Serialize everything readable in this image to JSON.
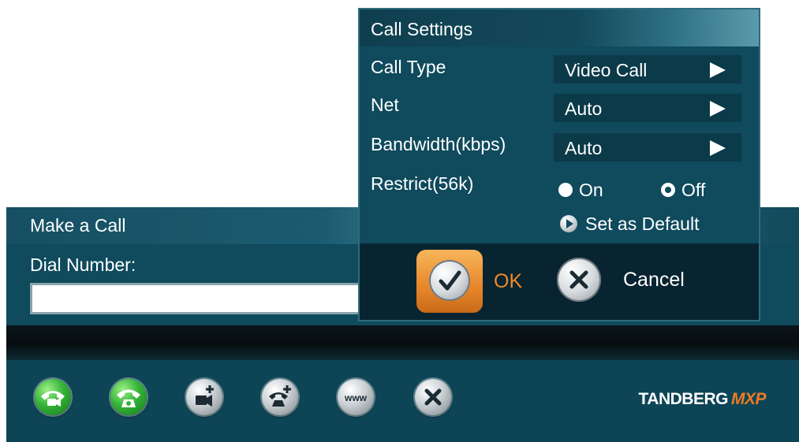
{
  "make_call": {
    "title": "Make a Call",
    "dial_label": "Dial Number:",
    "dial_value": ""
  },
  "toolbar": {
    "icons": [
      "video-call-icon",
      "phone-call-icon",
      "add-video-call-icon",
      "add-phone-call-icon",
      "www-icon",
      "close-icon"
    ]
  },
  "brand": {
    "name": "TANDBERG",
    "model": "MXP",
    "accent_color": "#f07a23"
  },
  "call_settings": {
    "title": "Call Settings",
    "call_type": {
      "label": "Call Type",
      "value": "Video Call"
    },
    "net": {
      "label": "Net",
      "value": "Auto"
    },
    "bandwidth": {
      "label": "Bandwidth(kbps)",
      "value": "Auto"
    },
    "restrict": {
      "label": "Restrict(56k)",
      "options": [
        "On",
        "Off"
      ],
      "selected": "Off"
    },
    "set_default_label": "Set as Default",
    "ok_label": "OK",
    "cancel_label": "Cancel"
  },
  "colors": {
    "panel": "#0f4a5d",
    "ok_accent": "#f08a2a",
    "call_green": "#35b338"
  }
}
